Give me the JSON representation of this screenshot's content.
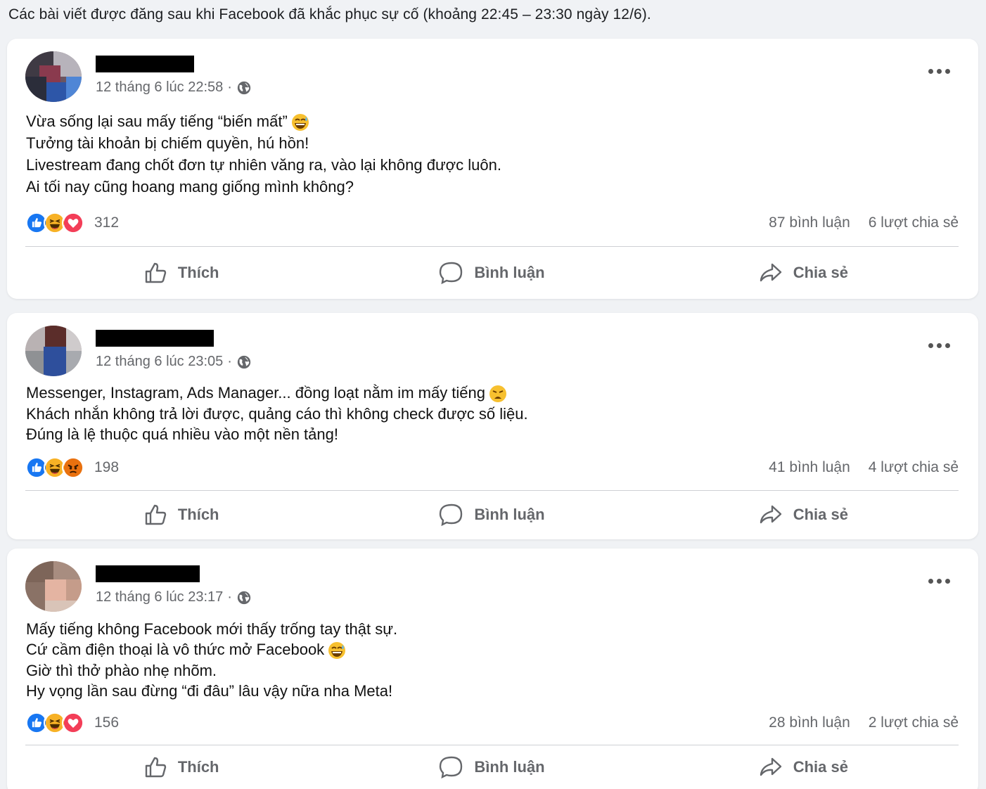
{
  "caption": "Các bài viết được đăng sau khi Facebook đã khắc phục sự cố (khoảng 22:45 – 23:30 ngày 12/6).",
  "colors": {
    "like_blue": "#1877f2",
    "haha_yellow": "#f7b125",
    "love_red": "#f33e58",
    "angry_orange": "#e9710f",
    "secondary_text": "#65676b"
  },
  "action_labels": {
    "like": "Thích",
    "comment": "Bình luận",
    "share": "Chia sẻ"
  },
  "posts": [
    {
      "timestamp": "12 tháng 6 lúc 22:58",
      "separator": "·",
      "privacy_icon": "globe-icon",
      "lines": [
        "Vừa sống lại sau mấy tiếng “biến mất”",
        "Tưởng tài khoản bị chiếm quyền, hú hồn!",
        "Livestream đang chốt đơn tự nhiên văng ra, vào lại không được luôn.",
        "Ai tối nay cũng hoang mang giống mình không?"
      ],
      "reactions": [
        "like",
        "haha",
        "love"
      ],
      "reaction_count": "312",
      "comments": "87 bình luận",
      "shares": "6 lượt chia sẻ"
    },
    {
      "timestamp": "12 tháng 6 lúc 23:05",
      "separator": "·",
      "privacy_icon": "globe-icon",
      "lines": [
        "Messenger, Instagram, Ads Manager... đồng loạt nằm im mấy tiếng",
        "Khách nhắn không trả lời được, quảng cáo thì không check được số liệu.",
        "Đúng là lệ thuộc quá nhiều vào một nền tảng!"
      ],
      "reactions": [
        "like",
        "haha",
        "angry"
      ],
      "reaction_count": "198",
      "comments": "41 bình luận",
      "shares": "4 lượt chia sẻ"
    },
    {
      "timestamp": "12 tháng 6 lúc 23:17",
      "separator": "·",
      "privacy_icon": "globe-icon",
      "lines": [
        "Mấy tiếng không Facebook mới thấy trống tay thật sự.",
        "Cứ cầm điện thoại là vô thức mở Facebook",
        "Giờ thì thở phào nhẹ nhõm.",
        "Hy vọng lần sau đừng “đi đâu” lâu vậy nữa nha Meta!"
      ],
      "reactions": [
        "like",
        "haha",
        "love"
      ],
      "reaction_count": "156",
      "comments": "28 bình luận",
      "shares": "2 lượt chia sẻ"
    }
  ]
}
